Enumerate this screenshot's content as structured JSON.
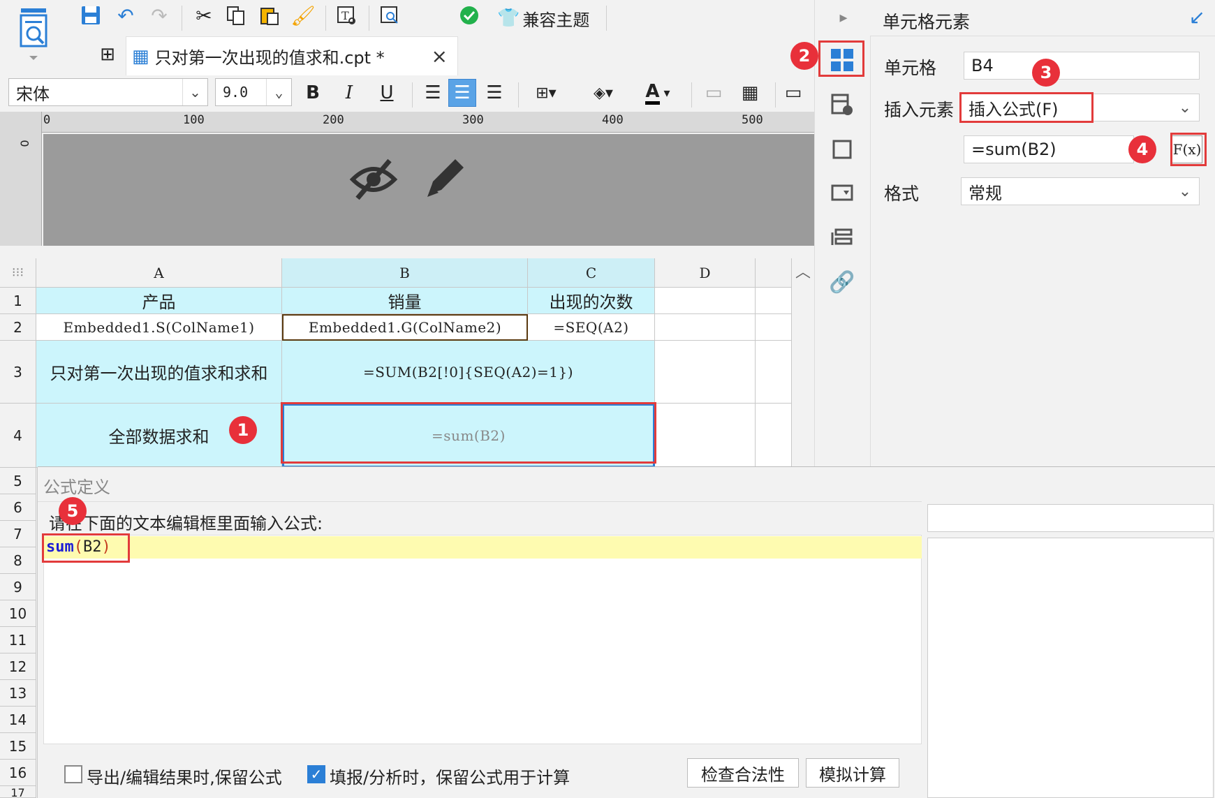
{
  "toolbar": {
    "compat_theme_label": "兼容主题",
    "icons": [
      "preview-icon",
      "save-icon",
      "undo-icon",
      "redo-icon",
      "cut-icon",
      "copy-icon",
      "paste-icon",
      "format-brush-icon",
      "text-icon",
      "inspect-icon",
      "check-icon",
      "theme-icon"
    ]
  },
  "tab": {
    "title": "只对第一次出现的值求和.cpt *",
    "close": "×"
  },
  "format": {
    "font_name": "宋体",
    "font_size": "9.0",
    "bold": "B",
    "italic": "I",
    "underline": "U",
    "font_color_letter": "A"
  },
  "ruler": {
    "labels": [
      "0",
      "100",
      "200",
      "300",
      "400",
      "500"
    ],
    "vertical_label": "0"
  },
  "grid": {
    "columns": [
      "A",
      "B",
      "C",
      "D"
    ],
    "rows": [
      "1",
      "2",
      "3",
      "4",
      "5",
      "6",
      "7",
      "8",
      "9",
      "10",
      "11",
      "12",
      "13",
      "14",
      "15",
      "16",
      "17"
    ],
    "cells": {
      "A1": "产品",
      "B1": "销量",
      "C1": "出现的次数",
      "A2": "Embedded1.S(ColName1)",
      "B2": "Embedded1.G(ColName2)",
      "C2": "=SEQ(A2)",
      "A3": "只对第一次出现的值求和求和",
      "B3": "=SUM(B2[!0]{SEQ(A2)=1})",
      "A4": "全部数据求和",
      "B4": "=sum(B2)"
    }
  },
  "properties": {
    "header": "单元格元素",
    "cell_label": "单元格",
    "cell_value": "B4",
    "insert_label": "插入元素",
    "insert_value": "插入公式(F)",
    "formula_value": "=sum(B2)",
    "fx_label": "F(x)",
    "format_label": "格式",
    "format_value": "常规"
  },
  "dialog": {
    "title": "公式定义",
    "hint": "请在下面的文本编辑框里面输入公式:",
    "formula_fn": "sum",
    "formula_open": "(",
    "formula_arg": "B2",
    "formula_close": ")",
    "option1": "导出/编辑结果时,保留公式",
    "option1_checked": false,
    "option2": "填报/分析时，保留公式用于计算",
    "option2_checked": true,
    "check_button": "检查合法性",
    "simulate_button": "模拟计算"
  },
  "annotations": [
    "1",
    "2",
    "3",
    "4",
    "5"
  ],
  "colors": {
    "accent": "#2b7fd6",
    "annotation_red": "#e23b3b",
    "cell_cyan": "#ccf5fc",
    "editor_highlight": "#fefbb0"
  }
}
